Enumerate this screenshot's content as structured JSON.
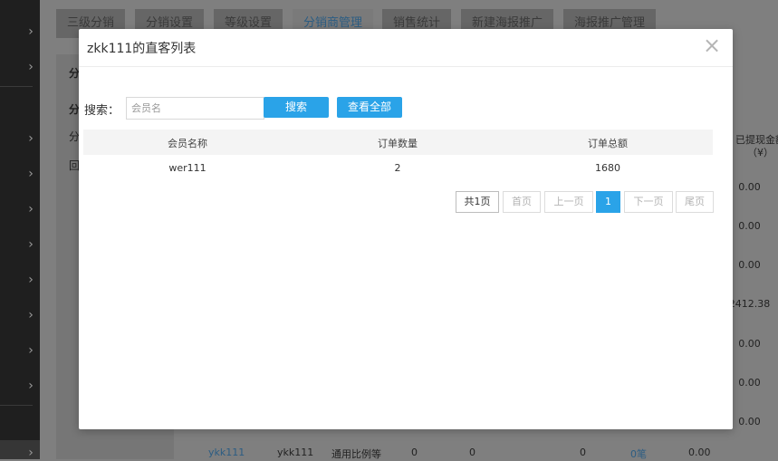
{
  "background": {
    "tabs": [
      "三级分销",
      "分销设置",
      "等级设置",
      "分销商管理",
      "销售统计",
      "新建海报推广",
      "海报推广管理"
    ],
    "active_tab_index": 3,
    "left_panel": [
      "分",
      "分",
      "分",
      "回"
    ],
    "right_column": {
      "header_line1": "已提现金额",
      "header_line2": "（¥）",
      "values": [
        "0.00",
        "0.00",
        "0.00",
        "2412.38",
        "0.00",
        "0.00",
        "0.00"
      ]
    },
    "bottom_row": [
      "ykk111",
      "ykk111",
      "通用比例等",
      "0",
      "0",
      "0",
      "0笔",
      "0.00"
    ]
  },
  "modal": {
    "title": "zkk111的直客列表",
    "close_icon": "close-icon",
    "search": {
      "label": "搜索：",
      "placeholder": "会员名",
      "value": "",
      "search_button": "搜索",
      "view_all_button": "查看全部"
    },
    "table": {
      "headers": [
        "会员名称",
        "订单数量",
        "订单总额"
      ],
      "rows": [
        [
          "wer111",
          "2",
          "1680"
        ]
      ]
    },
    "pager": {
      "total": "共1页",
      "first": "首页",
      "prev": "上一页",
      "current": "1",
      "next": "下一页",
      "last": "尾页"
    },
    "accent_color": "#2aa3e8"
  }
}
